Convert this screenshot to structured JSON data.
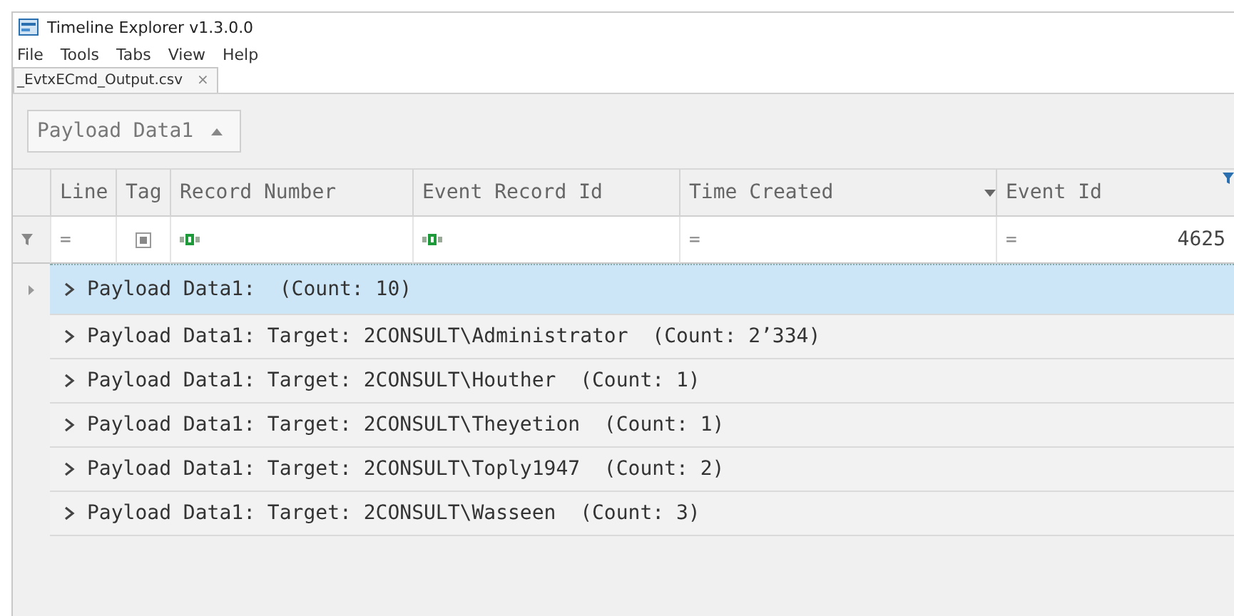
{
  "window": {
    "title": "Timeline Explorer v1.3.0.0"
  },
  "menu": [
    "File",
    "Tools",
    "Tabs",
    "View",
    "Help"
  ],
  "tabs": [
    {
      "label": "_EvtxECmd_Output.csv",
      "selected": true,
      "close": "×"
    }
  ],
  "group_panel": {
    "field": "Payload Data1",
    "ascending": true
  },
  "table": {
    "columns": [
      {
        "label": "Line",
        "kind": "plain",
        "filter": "="
      },
      {
        "label": "Tag",
        "kind": "check",
        "filter_indeterminate": true
      },
      {
        "label": "Record Number",
        "kind": "text"
      },
      {
        "label": "Event Record Id",
        "kind": "text"
      },
      {
        "label": "Time Created",
        "kind": "plain",
        "filter": "=",
        "sorted": true
      },
      {
        "label": "Event Id",
        "kind": "plain",
        "filter": "=",
        "filter_value": "4625",
        "filtered": true
      }
    ],
    "groups": [
      {
        "label": "Payload Data1:",
        "count": "(Count: 10)",
        "selected": true,
        "expanded": false
      },
      {
        "label": "Payload Data1:",
        "value": "Target: 2CONSULT\\Administrator",
        "count": "(Count: 2’334)",
        "selected": false,
        "expanded": false
      },
      {
        "label": "Payload Data1:",
        "value": "Target: 2CONSULT\\Houther",
        "count": "(Count: 1)",
        "selected": false,
        "expanded": false
      },
      {
        "label": "Payload Data1:",
        "value": "Target: 2CONSULT\\Theyetion",
        "count": "(Count: 1)",
        "selected": false,
        "expanded": false
      },
      {
        "label": "Payload Data1:",
        "value": "Target: 2CONSULT\\Toply1947",
        "count": "(Count: 2)",
        "selected": false,
        "expanded": false
      },
      {
        "label": "Payload Data1:",
        "value": "Target: 2CONSULT\\Wasseen",
        "count": "(Count: 3)",
        "selected": false,
        "expanded": false
      }
    ]
  }
}
